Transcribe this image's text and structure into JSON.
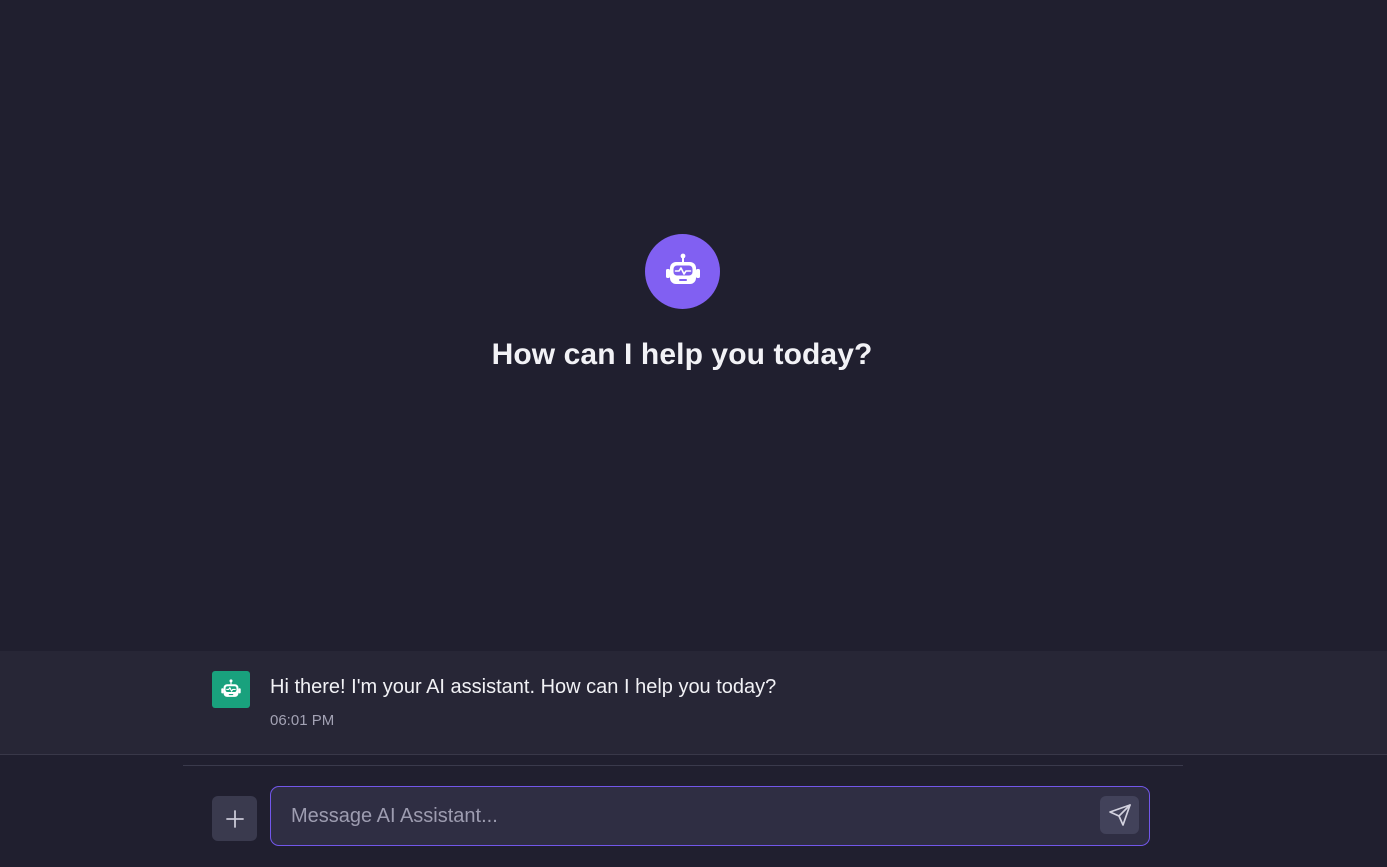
{
  "hero": {
    "icon": "robot-icon",
    "title": "How can I help you today?",
    "accent_color": "#8160f2"
  },
  "messages": [
    {
      "sender_icon": "robot-icon",
      "avatar_color": "#19a17d",
      "text": "Hi there! I'm your AI assistant. How can I help you today?",
      "time": "06:01 PM"
    }
  ],
  "composer": {
    "placeholder": "Message AI Assistant...",
    "value": "",
    "attach_icon": "plus-icon",
    "send_icon": "send-icon"
  }
}
